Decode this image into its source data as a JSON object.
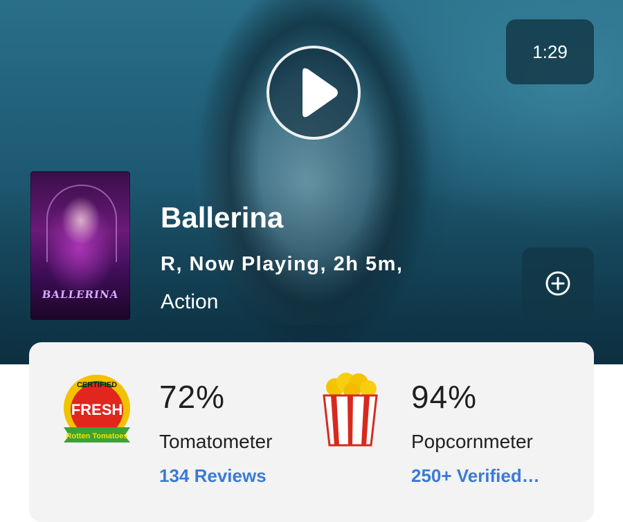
{
  "trailer": {
    "duration": "1:29",
    "play_icon": "play-icon"
  },
  "movie": {
    "title": "Ballerina",
    "meta": "R, Now Playing, 2h 5m,",
    "genre": "Action",
    "poster_title": "BALLERINA"
  },
  "actions": {
    "add_icon": "plus-circle-icon"
  },
  "scores": {
    "tomatometer": {
      "value": "72%",
      "label": "Tomatometer",
      "link": "134 Reviews",
      "badge_icon": "certified-fresh-icon",
      "badge_top": "CERTIFIED",
      "badge_mid": "FRESH",
      "badge_bottom": "Rotten Tomatoes"
    },
    "popcornmeter": {
      "value": "94%",
      "label": "Popcornmeter",
      "link": "250+ Verified…",
      "badge_icon": "popcorn-icon"
    }
  },
  "colors": {
    "link": "#3a7bd5",
    "card_bg": "#f3f3f3",
    "hero_bg": "#1e5a73"
  }
}
